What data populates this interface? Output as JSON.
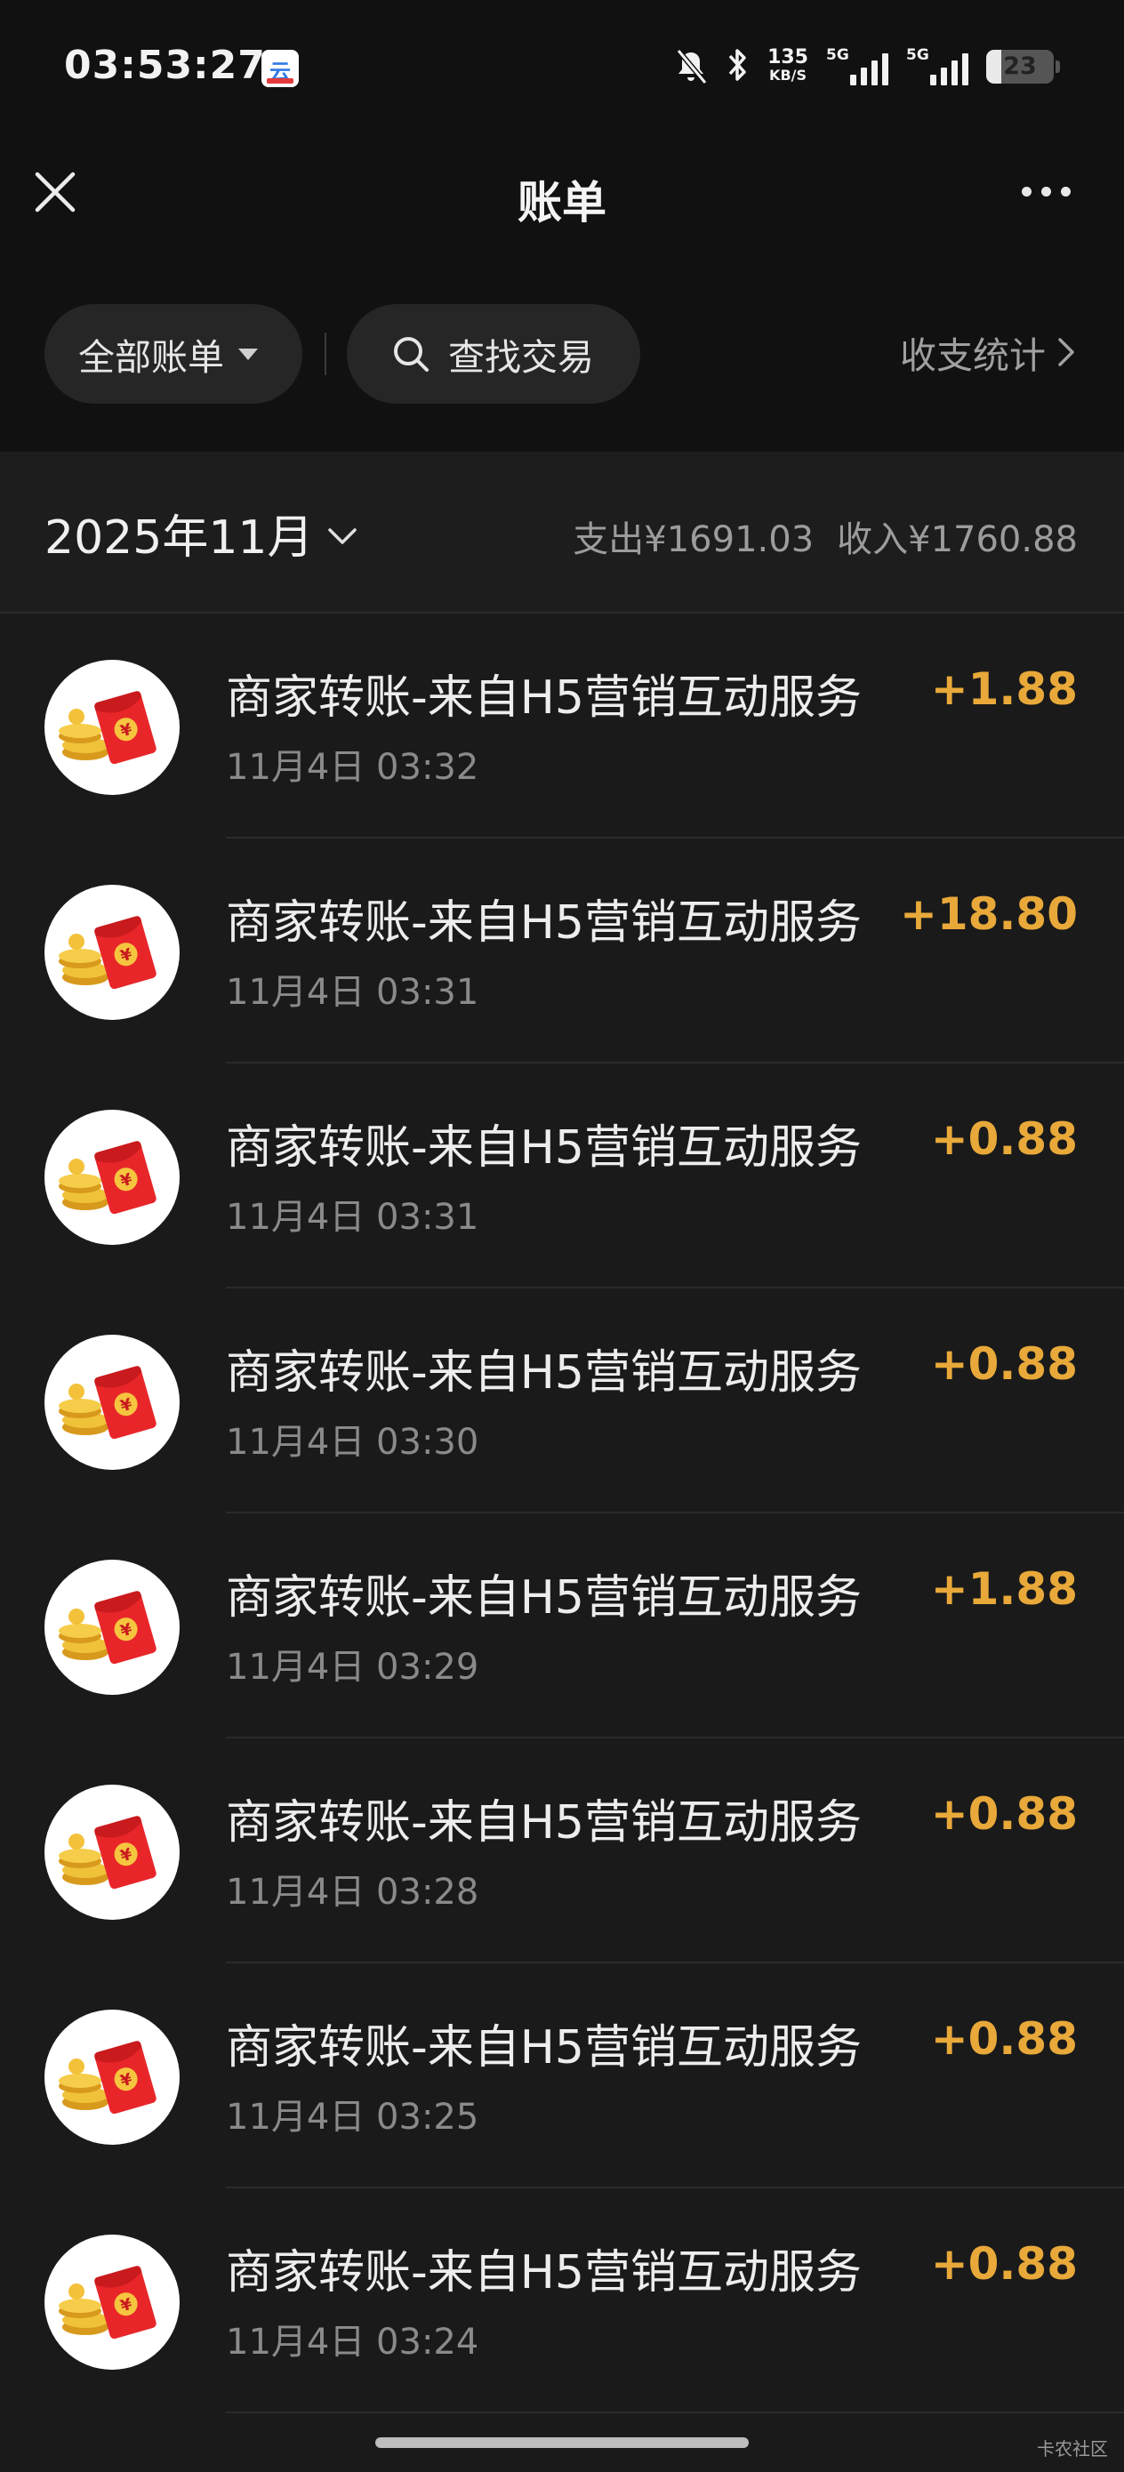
{
  "status_bar": {
    "time": "03:53:27",
    "app_badge_glyph": "云",
    "net_speed_value": "135",
    "net_speed_unit": "KB/S",
    "sim1_tag": "5G",
    "sim2_tag": "5G",
    "battery": "23",
    "icons": [
      "bell-off-icon",
      "bluetooth-icon",
      "signal-icon",
      "battery-icon"
    ]
  },
  "nav": {
    "title": "账单",
    "close_icon": "close-icon",
    "more_icon": "more-dots-icon"
  },
  "filters": {
    "all_label": "全部账单",
    "search_label": "查找交易",
    "stats_label": "收支统计"
  },
  "month": {
    "label": "2025年11月",
    "expense": "支出¥1691.03",
    "income": "收入¥1760.88"
  },
  "transactions": [
    {
      "name": "商家转账-来自H5营销互动服务",
      "time": "11月4日 03:32",
      "amount": "+1.88"
    },
    {
      "name": "商家转账-来自H5营销互动服务",
      "time": "11月4日 03:31",
      "amount": "+18.80"
    },
    {
      "name": "商家转账-来自H5营销互动服务",
      "time": "11月4日 03:31",
      "amount": "+0.88"
    },
    {
      "name": "商家转账-来自H5营销互动服务",
      "time": "11月4日 03:30",
      "amount": "+0.88"
    },
    {
      "name": "商家转账-来自H5营销互动服务",
      "time": "11月4日 03:29",
      "amount": "+1.88"
    },
    {
      "name": "商家转账-来自H5营销互动服务",
      "time": "11月4日 03:28",
      "amount": "+0.88"
    },
    {
      "name": "商家转账-来自H5营销互动服务",
      "time": "11月4日 03:25",
      "amount": "+0.88"
    },
    {
      "name": "商家转账-来自H5营销互动服务",
      "time": "11月4日 03:24",
      "amount": "+0.88"
    }
  ],
  "watermark": "卡农社区",
  "colors": {
    "amount": "#e8a93a",
    "background": "#1a1a1a",
    "header": "#111111",
    "pill": "#262626"
  }
}
